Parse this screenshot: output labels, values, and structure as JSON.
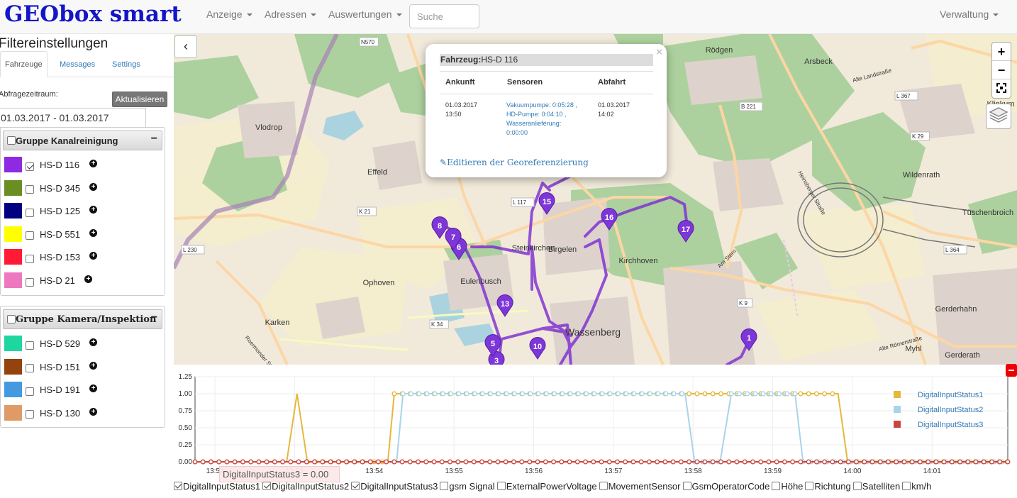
{
  "app": {
    "brand": "GEObox smart"
  },
  "nav": {
    "items": [
      "Anzeige",
      "Adressen",
      "Auswertungen"
    ],
    "search_placeholder": "Suche",
    "right": "Verwaltung"
  },
  "sidebar": {
    "title": "Filtereinstellungen",
    "tabs": [
      "Fahrzeuge",
      "Messages",
      "Settings"
    ],
    "range_label": "Abfragezeitraum:",
    "refresh_label": "Aktualisieren",
    "date_range": "01.03.2017 - 01.03.2017",
    "groups": [
      {
        "name": "Gruppe Kanalreinigung",
        "vehicles": [
          {
            "id": "HS-D 116",
            "color": "#8e2be2",
            "checked": true
          },
          {
            "id": "HS-D 345",
            "color": "#6b8e23",
            "checked": false
          },
          {
            "id": "HS-D 125",
            "color": "#000080",
            "checked": false
          },
          {
            "id": "HS-D 551",
            "color": "#ffff00",
            "checked": false
          },
          {
            "id": "HS-D 153",
            "color": "#ff1a35",
            "checked": false
          },
          {
            "id": "HS-D 21",
            "color": "#ee78c0",
            "checked": false
          }
        ]
      },
      {
        "name": "Gruppe Kamera/Inspektion",
        "vehicles": [
          {
            "id": "HS-D 529",
            "color": "#1fd6a0",
            "checked": false
          },
          {
            "id": "HS-D 151",
            "color": "#94420e",
            "checked": false
          },
          {
            "id": "HS-D 191",
            "color": "#4499e0",
            "checked": false
          },
          {
            "id": "HS-D 130",
            "color": "#e09a66",
            "checked": false
          }
        ]
      }
    ]
  },
  "map": {
    "places": [
      "Vlodrop",
      "Effeld",
      "Steinkirchen",
      "Ophoven",
      "Karken",
      "Kirchhoven",
      "Eulenbusch",
      "Birgelen",
      "Wassenberg",
      "Rödgen",
      "Arsbeck",
      "Klinkum",
      "Wildenrath",
      "Tüschenbroich",
      "Gerderhahn",
      "Gerderath",
      "Myhl"
    ],
    "roads": [
      "N570",
      "L 117",
      "K 21",
      "L 230",
      "K 34",
      "B 221",
      "L 367",
      "K 29",
      "L 364",
      "K 9",
      "Alte Landstraße",
      "Am Stern",
      "Roermonder Straße",
      "Alte Römerstraße",
      "Heinsberger Straße"
    ],
    "markers": [
      "1",
      "3",
      "5",
      "6",
      "7",
      "8",
      "10",
      "13",
      "15",
      "16",
      "17"
    ],
    "popup": {
      "vehicle_label": "Fahrzeug:",
      "vehicle_value": "HS-D 116",
      "col_arrival": "Ankunft",
      "col_sensors": "Sensoren",
      "col_departure": "Abfahrt",
      "arrival_date": "01.03.2017",
      "arrival_time": "13:50",
      "sensor_lines": [
        "Vakuumpumpe: 0:05:28 ,",
        "HD-Pumpe: 0:04:10 ,",
        "Wasseranlieferung:",
        "0:00:00"
      ],
      "departure_date": "01.03.2017",
      "departure_time": "14:02",
      "edit_link": "Editieren der Georeferenzierung"
    },
    "controls": {
      "zoom_in": "+",
      "zoom_out": "−"
    }
  },
  "chart_data": {
    "type": "line",
    "x_ticks": [
      "13:52",
      "13:53",
      "13:54",
      "13:55",
      "13:56",
      "13:57",
      "13:58",
      "13:59",
      "14:00",
      "14:01"
    ],
    "y_ticks": [
      "0.00",
      "0.25",
      "0.50",
      "0.75",
      "1.00",
      "1.25"
    ],
    "ylim": [
      0,
      1.25
    ],
    "x_range_min": [
      51.75,
      61.95
    ],
    "series": [
      {
        "name": "DigitalInputStatus1",
        "color": "#e5b83c",
        "points": [
          [
            51.75,
            0
          ],
          [
            52.9,
            0
          ],
          [
            53.03,
            1
          ],
          [
            53.16,
            0
          ],
          [
            54.0,
            0
          ],
          [
            54.17,
            0
          ],
          [
            54.25,
            1
          ],
          [
            59.82,
            1
          ],
          [
            59.94,
            0
          ],
          [
            61.95,
            0
          ]
        ]
      },
      {
        "name": "DigitalInputStatus2",
        "color": "#a9d3ec",
        "points": [
          [
            51.75,
            0
          ],
          [
            54.28,
            0
          ],
          [
            54.36,
            1
          ],
          [
            57.9,
            1
          ],
          [
            58.02,
            0
          ],
          [
            58.34,
            0
          ],
          [
            58.48,
            1
          ],
          [
            59.28,
            1
          ],
          [
            59.38,
            0
          ],
          [
            61.95,
            0
          ]
        ]
      },
      {
        "name": "DigitalInputStatus3",
        "color": "#c94640",
        "points": [
          [
            51.75,
            0
          ],
          [
            61.95,
            0
          ]
        ]
      }
    ],
    "legend_position": "right",
    "tooltip": "DigitalInputStatus3 = 0.00",
    "toggles": [
      {
        "label": "DigitalInputStatus1",
        "checked": true
      },
      {
        "label": "DigitalInputStatus2",
        "checked": true
      },
      {
        "label": "DigitalInputStatus3",
        "checked": true
      },
      {
        "label": "gsm Signal",
        "checked": false
      },
      {
        "label": "ExternalPowerVoltage",
        "checked": false
      },
      {
        "label": "MovementSensor",
        "checked": false
      },
      {
        "label": "GsmOperatorCode",
        "checked": false
      },
      {
        "label": "Höhe",
        "checked": false
      },
      {
        "label": "Richtung",
        "checked": false
      },
      {
        "label": "Satelliten",
        "checked": false
      },
      {
        "label": "km/h",
        "checked": false
      }
    ]
  }
}
